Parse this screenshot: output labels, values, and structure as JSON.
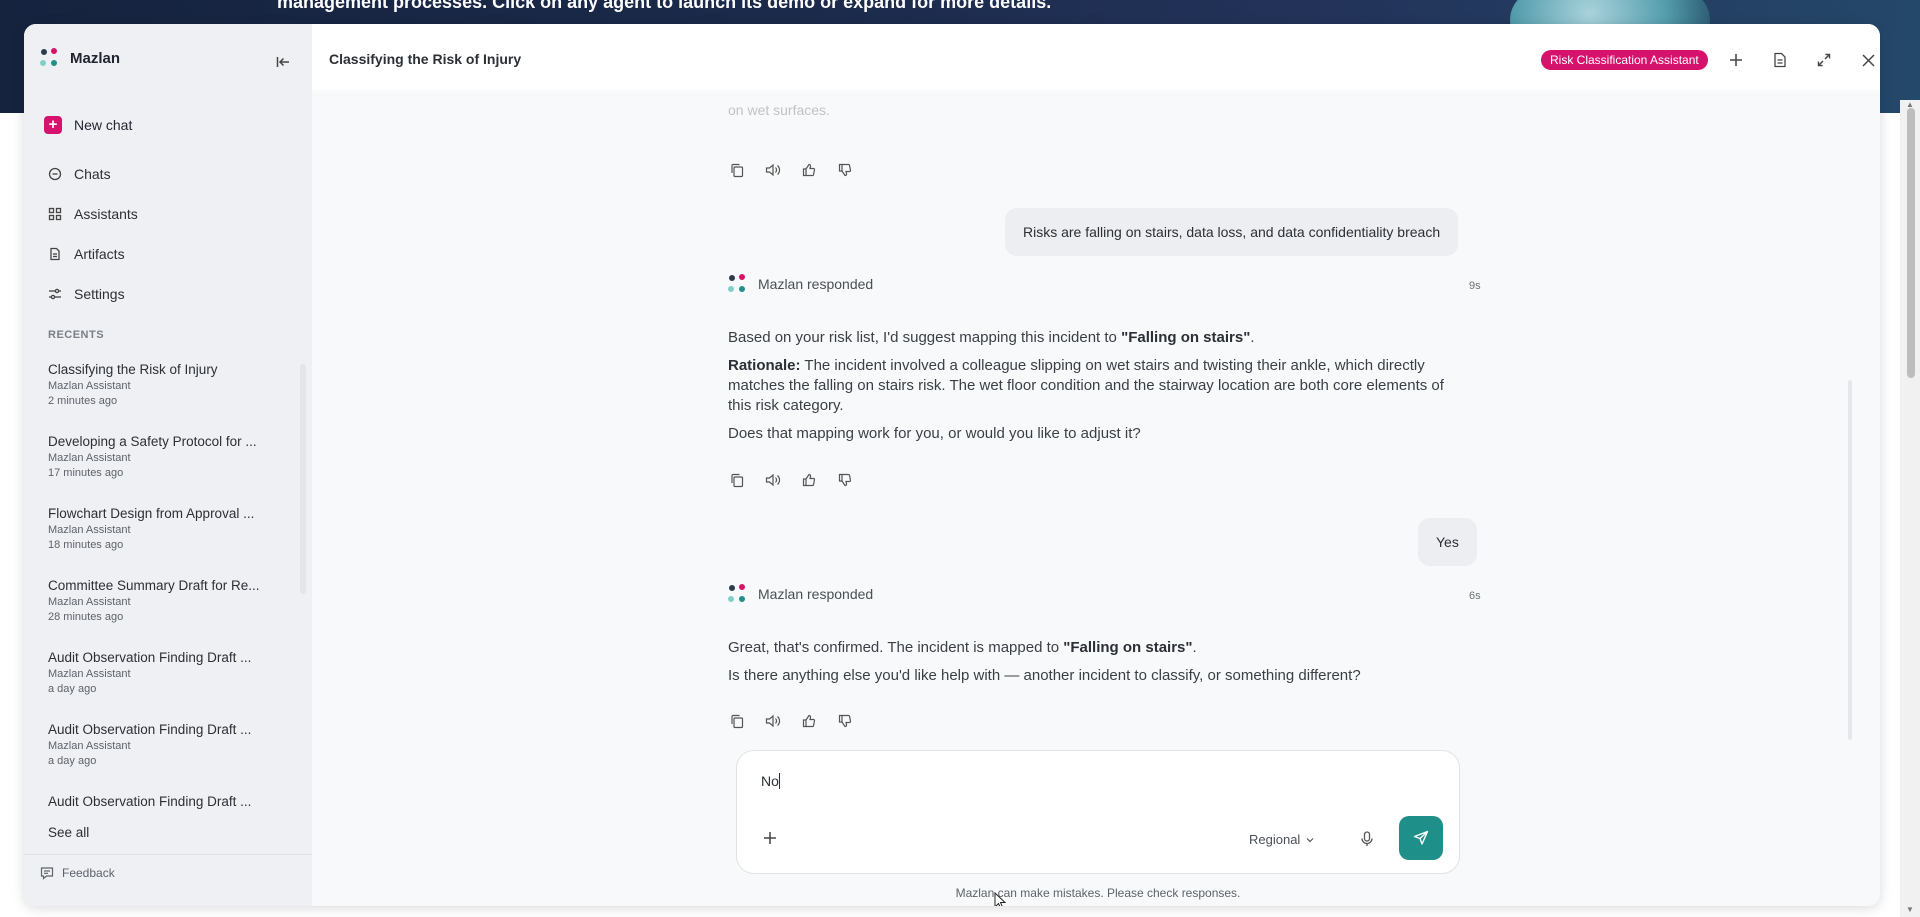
{
  "background": {
    "banner_text": "management processes. Click on any agent to launch its demo or expand for more details."
  },
  "sidebar": {
    "brand": "Mazlan",
    "new_chat": "New chat",
    "nav": [
      {
        "label": "Chats",
        "icon": "chat-icon"
      },
      {
        "label": "Assistants",
        "icon": "grid-icon"
      },
      {
        "label": "Artifacts",
        "icon": "document-icon"
      },
      {
        "label": "Settings",
        "icon": "sliders-icon"
      }
    ],
    "recents_title": "RECENTS",
    "recents": [
      {
        "title": "Classifying the Risk of Injury",
        "assistant": "Mazlan Assistant",
        "time": "2 minutes ago"
      },
      {
        "title": "Developing a Safety Protocol for ...",
        "assistant": "Mazlan Assistant",
        "time": "17 minutes ago"
      },
      {
        "title": "Flowchart Design from Approval ...",
        "assistant": "Mazlan Assistant",
        "time": "18 minutes ago"
      },
      {
        "title": "Committee Summary Draft for Re...",
        "assistant": "Mazlan Assistant",
        "time": "28 minutes ago"
      },
      {
        "title": "Audit Observation Finding Draft ...",
        "assistant": "Mazlan Assistant",
        "time": "a day ago"
      },
      {
        "title": "Audit Observation Finding Draft ...",
        "assistant": "Mazlan Assistant",
        "time": "a day ago"
      },
      {
        "title": "Audit Observation Finding Draft ...",
        "assistant": "",
        "time": ""
      }
    ],
    "see_all": "See all",
    "feedback": "Feedback"
  },
  "header": {
    "title": "Classifying the Risk of Injury",
    "badge": "Risk Classification Assistant"
  },
  "chat": {
    "faded_top": "on wet surfaces.",
    "user_message_1": "Risks are falling on stairs, data loss, and data confidentiality breach",
    "response_1": {
      "name": "Mazlan responded",
      "time": "9s",
      "p1_pre": "Based on your risk list, I'd suggest mapping this incident to ",
      "p1_bold": "\"Falling on stairs\"",
      "p1_post": ".",
      "p2_bold": "Rationale:",
      "p2_text": " The incident involved a colleague slipping on wet stairs and twisting their ankle, which directly matches the falling on stairs risk. The wet floor condition and the stairway location are both core elements of this risk category.",
      "p3": "Does that mapping work for you, or would you like to adjust it?"
    },
    "user_message_2": "Yes",
    "response_2": {
      "name": "Mazlan responded",
      "time": "6s",
      "p1_pre": "Great, that's confirmed. The incident is mapped to ",
      "p1_bold": "\"Falling on stairs\"",
      "p1_post": ".",
      "p2": "Is there anything else you'd like help with — another incident to classify, or something different?"
    }
  },
  "composer": {
    "value": "No",
    "model": "Regional"
  },
  "disclaimer": "Mazlan can make mistakes. Please check responses.",
  "colors": {
    "accent": "#d6126d",
    "send": "#1f8f8a"
  }
}
